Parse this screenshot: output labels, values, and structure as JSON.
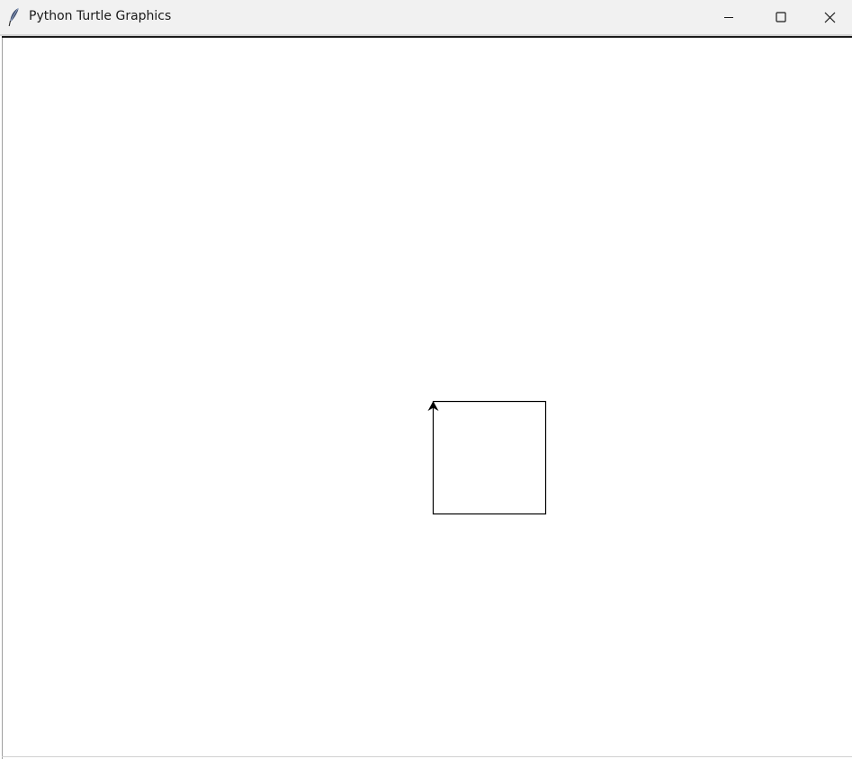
{
  "window": {
    "title": "Python Turtle Graphics",
    "app_icon": "feather-icon",
    "controls": {
      "minimize_icon": "minimize-icon",
      "maximize_icon": "maximize-icon",
      "close_icon": "close-icon"
    }
  },
  "canvas": {
    "background": "#ffffff",
    "pen_color": "#000000",
    "shape": "square",
    "turtle_heading": "up",
    "turtle_icon": "turtle-arrow-icon"
  }
}
